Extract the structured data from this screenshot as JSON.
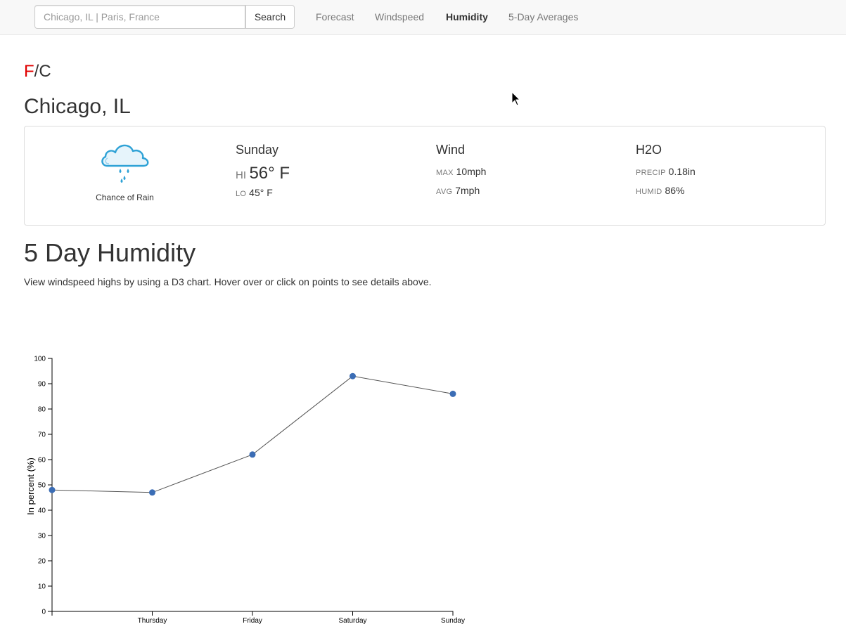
{
  "navbar": {
    "search_placeholder": "Chicago, IL | Paris, France",
    "search_button": "Search",
    "links": [
      {
        "label": "Forecast",
        "active": false
      },
      {
        "label": "Windspeed",
        "active": false
      },
      {
        "label": "Humidity",
        "active": true
      },
      {
        "label": "5-Day Averages",
        "active": false
      }
    ]
  },
  "units": {
    "f": "F",
    "sep": "/",
    "c": "C",
    "active": "F",
    "active_color": "#e00000"
  },
  "city": "Chicago, IL",
  "forecast": {
    "icon": "rain-cloud-icon",
    "condition": "Chance of Rain",
    "day": "Sunday",
    "hi_label": "HI",
    "hi_value": "56° F",
    "lo_label": "LO",
    "lo_value": "45° F",
    "wind": {
      "title": "Wind",
      "max_label": "MAX",
      "max_value": "10mph",
      "avg_label": "AVG",
      "avg_value": "7mph"
    },
    "h2o": {
      "title": "H2O",
      "precip_label": "PRECIP",
      "precip_value": "0.18in",
      "humid_label": "HUMID",
      "humid_value": "86%"
    }
  },
  "section": {
    "title": "5 Day Humidity",
    "description": "View windspeed highs by using a D3 chart. Hover over or click on points to see details above."
  },
  "chart_data": {
    "type": "line",
    "title": "",
    "xlabel": "",
    "ylabel": "In percent (%)",
    "categories": [
      "",
      "Thursday",
      "Friday",
      "Saturday",
      "Sunday"
    ],
    "values": [
      48,
      47,
      62,
      93,
      86
    ],
    "ylim": [
      0,
      100
    ],
    "yticks": [
      0,
      10,
      20,
      30,
      40,
      50,
      60,
      70,
      80,
      90,
      100
    ],
    "grid": false,
    "line_color": "#555555",
    "point_color": "#3b6db5"
  }
}
